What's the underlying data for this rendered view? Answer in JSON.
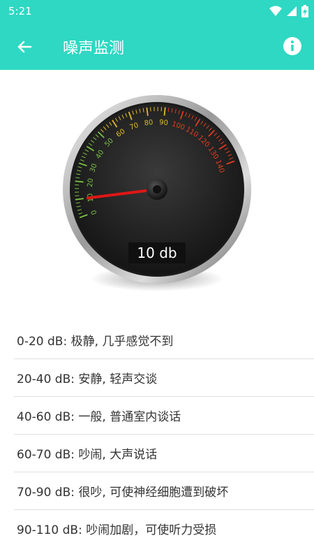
{
  "status_bar": {
    "time": "5:21",
    "icons": [
      "wifi-icon",
      "cellular-signal-icon",
      "battery-charging-icon"
    ]
  },
  "app_bar": {
    "title": "噪声监测",
    "back_icon": "arrow-left-icon",
    "info_icon": "info-icon"
  },
  "gauge": {
    "current_value": 10,
    "reading_text": "10 db",
    "min": 0,
    "max": 140,
    "ticks": [
      "0",
      "10",
      "20",
      "30",
      "40",
      "50",
      "60",
      "70",
      "80",
      "90",
      "100",
      "110",
      "120",
      "130",
      "140"
    ]
  },
  "noise_levels": [
    "0-20 dB: 极静, 几乎感觉不到",
    "20-40 dB: 安静, 轻声交谈",
    "40-60 dB: 一般, 普通室内谈话",
    "60-70 dB: 吵闹, 大声说话",
    "70-90 dB: 很吵, 可使神经细胞遭到破坏",
    "90-110 dB: 吵闹加剧，可使听力受损"
  ],
  "colors": {
    "primary": "#2ed8c3",
    "tick_low": "#7bc043",
    "tick_mid": "#e0b72a",
    "tick_high": "#e23c1f",
    "needle": "#e01616"
  }
}
